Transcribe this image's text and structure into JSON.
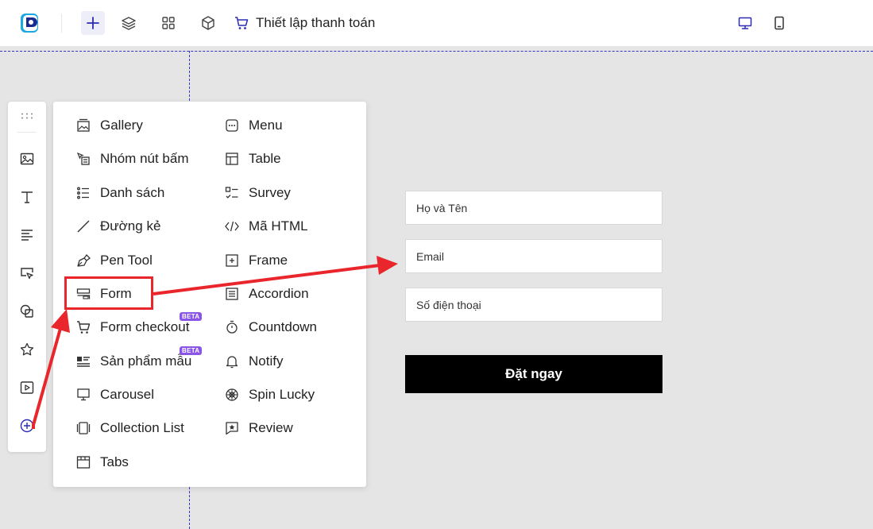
{
  "topbar": {
    "page_title": "Thiết lập thanh toán",
    "accent_color": "#2b2bb5",
    "buttons": [
      "add-icon",
      "layers-icon",
      "apps-grid-icon",
      "cube-icon",
      "cart-icon",
      "desktop-icon",
      "mobile-icon"
    ]
  },
  "left_toolbar": {
    "tools": [
      "image-icon",
      "text-icon",
      "paragraph-icon",
      "button-cursor-icon",
      "shapes-icon",
      "star-icon",
      "video-icon",
      "add-circle-icon"
    ]
  },
  "menu": {
    "left_column": [
      {
        "label": "Gallery",
        "icon": "gallery-icon"
      },
      {
        "label": "Nhóm nút bấm",
        "icon": "button-group-icon"
      },
      {
        "label": "Danh sách",
        "icon": "list-icon"
      },
      {
        "label": "Đường kẻ",
        "icon": "line-icon"
      },
      {
        "label": "Pen Tool",
        "icon": "pen-tool-icon"
      },
      {
        "label": "Form",
        "icon": "form-icon"
      },
      {
        "label": "Form checkout",
        "icon": "cart-icon",
        "badge": "BETA"
      },
      {
        "label": "Sản phẩm mẫu",
        "icon": "product-icon",
        "badge": "BETA"
      },
      {
        "label": "Carousel",
        "icon": "carousel-icon"
      },
      {
        "label": "Collection List",
        "icon": "collection-icon"
      },
      {
        "label": "Tabs",
        "icon": "tabs-icon"
      }
    ],
    "right_column": [
      {
        "label": "Menu",
        "icon": "menu-dots-icon"
      },
      {
        "label": "Table",
        "icon": "table-icon"
      },
      {
        "label": "Survey",
        "icon": "survey-icon"
      },
      {
        "label": "Mã HTML",
        "icon": "code-icon"
      },
      {
        "label": "Frame",
        "icon": "frame-icon"
      },
      {
        "label": "Accordion",
        "icon": "accordion-icon"
      },
      {
        "label": "Countdown",
        "icon": "timer-icon"
      },
      {
        "label": "Notify",
        "icon": "bell-icon"
      },
      {
        "label": "Spin Lucky",
        "icon": "wheel-icon"
      },
      {
        "label": "Review",
        "icon": "review-star-icon"
      }
    ]
  },
  "form_preview": {
    "fields": [
      {
        "placeholder": "Họ và Tên"
      },
      {
        "placeholder": "Email"
      },
      {
        "placeholder": "Số điện thoại"
      }
    ],
    "submit_label": "Đặt ngay"
  },
  "annotation_color": "#e8262b",
  "badge_color": "#8a55e6"
}
